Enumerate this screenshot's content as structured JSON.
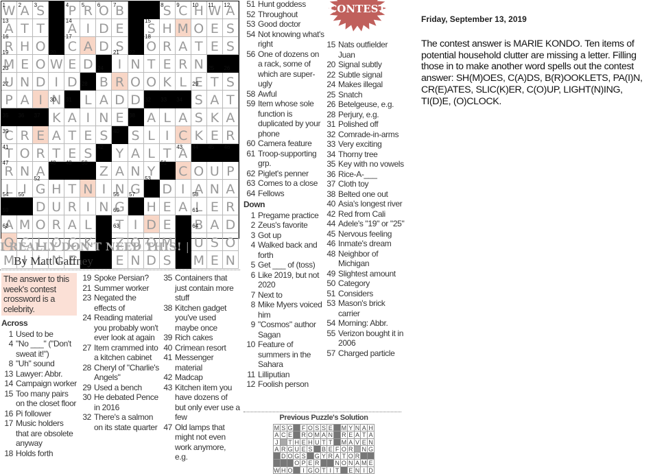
{
  "puzzle": {
    "title": "I REALLY DON'T NEED THIS!",
    "title_separator": "|",
    "byline": "By Matt Gaffney",
    "grid_rows": [
      "WAS#PROB##SCHWA",
      "ATT#AIDE#SHMOES",
      "RHO#CADS#ORATES",
      "MEOWED#INTERN##",
      "UNDID#BROOKLETS",
      "PAIN#LADD###SAT",
      "###KAINE#ALASKA",
      "CREATES#SLICKER",
      "TORTES#YALTA###",
      "RNA###ZANY#COUP",
      "LIGHTNING#DIANA",
      "##DURING#HEALER",
      "AMORAL#TIDE#BAD",
      "OCLOCK#ZOOM#USO",
      "MILNE##ENDS#MEN"
    ],
    "highlighted_cells": [
      [
        2,
        12
      ],
      [
        3,
        6
      ],
      [
        5,
        8
      ],
      [
        6,
        3
      ],
      [
        8,
        3
      ],
      [
        8,
        12
      ],
      [
        10,
        12
      ],
      [
        11,
        6
      ],
      [
        13,
        10
      ],
      [
        14,
        1
      ]
    ],
    "highlight_color": "#f8d6c6",
    "intro": "The answer to this week's contest crossword is a celebrity.",
    "across_label": "Across",
    "down_label": "Down",
    "across": [
      {
        "n": "1",
        "t": "Used to be"
      },
      {
        "n": "4",
        "t": "\"No ___\" (\"Don't sweat it!\")"
      },
      {
        "n": "8",
        "t": "\"Uh\" sound"
      },
      {
        "n": "13",
        "t": "Lawyer: Abbr."
      },
      {
        "n": "14",
        "t": "Campaign worker"
      },
      {
        "n": "15",
        "t": "Too many pairs on the closet floor"
      },
      {
        "n": "16",
        "t": "Pi follower"
      },
      {
        "n": "17",
        "t": "Music holders that are obsolete anyway"
      },
      {
        "n": "18",
        "t": "Holds forth"
      },
      {
        "n": "19",
        "t": "Spoke Persian?"
      },
      {
        "n": "21",
        "t": "Summer worker"
      },
      {
        "n": "23",
        "t": "Negated the effects of"
      },
      {
        "n": "24",
        "t": "Reading material you probably won't ever look at again"
      },
      {
        "n": "27",
        "t": "Item crammed into a kitchen cabinet"
      },
      {
        "n": "28",
        "t": "Cheryl of \"Charlie's Angels\""
      },
      {
        "n": "29",
        "t": "Used a bench"
      },
      {
        "n": "30",
        "t": "He debated Pence in 2016"
      },
      {
        "n": "32",
        "t": "There's a salmon on its state quarter"
      },
      {
        "n": "35",
        "t": "Containers that just contain more stuff"
      },
      {
        "n": "38",
        "t": "Kitchen gadget you've used maybe once"
      },
      {
        "n": "39",
        "t": "Rich cakes"
      },
      {
        "n": "40",
        "t": "Crimean resort"
      },
      {
        "n": "41",
        "t": "Messenger material"
      },
      {
        "n": "42",
        "t": "Madcap"
      },
      {
        "n": "43",
        "t": "Kitchen item you have dozens of but only ever use a few"
      },
      {
        "n": "47",
        "t": "Old lamps that might not even work anymore, e.g."
      },
      {
        "n": "51",
        "t": "Hunt goddess"
      },
      {
        "n": "52",
        "t": "Throughout"
      },
      {
        "n": "53",
        "t": "Good doctor"
      },
      {
        "n": "54",
        "t": "Not knowing what's right"
      },
      {
        "n": "56",
        "t": "One of dozens on a rack, some of which are super-ugly"
      },
      {
        "n": "58",
        "t": "Awful"
      },
      {
        "n": "59",
        "t": "Item whose sole function is duplicated by your phone"
      },
      {
        "n": "60",
        "t": "Camera feature"
      },
      {
        "n": "61",
        "t": "Troop-supporting grp."
      },
      {
        "n": "62",
        "t": "Piglet's penner"
      },
      {
        "n": "63",
        "t": "Comes to a close"
      },
      {
        "n": "64",
        "t": "Fellows"
      }
    ],
    "down": [
      {
        "n": "1",
        "t": "Pregame practice"
      },
      {
        "n": "2",
        "t": "Zeus's favorite"
      },
      {
        "n": "3",
        "t": "Got up"
      },
      {
        "n": "4",
        "t": "Walked back and forth"
      },
      {
        "n": "5",
        "t": "Get ___ of (toss)"
      },
      {
        "n": "6",
        "t": "Like 2019, but not 2020"
      },
      {
        "n": "7",
        "t": "Next to"
      },
      {
        "n": "8",
        "t": "Mike Myers voiced him"
      },
      {
        "n": "9",
        "t": "\"Cosmos\" author Sagan"
      },
      {
        "n": "10",
        "t": "Feature of summers in the Sahara"
      },
      {
        "n": "11",
        "t": "Lilliputian"
      },
      {
        "n": "12",
        "t": "Foolish person"
      },
      {
        "n": "15",
        "t": "Nats outfielder Juan"
      },
      {
        "n": "20",
        "t": "Signal subtly"
      },
      {
        "n": "22",
        "t": "Subtle signal"
      },
      {
        "n": "24",
        "t": "Makes illegal"
      },
      {
        "n": "25",
        "t": "Snatch"
      },
      {
        "n": "26",
        "t": "Betelgeuse, e.g."
      },
      {
        "n": "28",
        "t": "Perjury, e.g."
      },
      {
        "n": "31",
        "t": "Polished off"
      },
      {
        "n": "32",
        "t": "Comrade-in-arms"
      },
      {
        "n": "33",
        "t": "Very exciting"
      },
      {
        "n": "34",
        "t": "Thorny tree"
      },
      {
        "n": "35",
        "t": "Key with no vowels"
      },
      {
        "n": "36",
        "t": "Rice-A-___"
      },
      {
        "n": "37",
        "t": "Cloth toy"
      },
      {
        "n": "38",
        "t": "Belted one out"
      },
      {
        "n": "40",
        "t": "Asia's longest river"
      },
      {
        "n": "42",
        "t": "Red from Cali"
      },
      {
        "n": "44",
        "t": "Adele's \"19\" or \"25\""
      },
      {
        "n": "45",
        "t": "Nervous feeling"
      },
      {
        "n": "46",
        "t": "Inmate's dream"
      },
      {
        "n": "48",
        "t": "Neighbor of Michigan"
      },
      {
        "n": "49",
        "t": "Slightest amount"
      },
      {
        "n": "50",
        "t": "Category"
      },
      {
        "n": "51",
        "t": "Considers"
      },
      {
        "n": "53",
        "t": "Mason's brick carrier"
      },
      {
        "n": "54",
        "t": "Morning: Abbr."
      },
      {
        "n": "55",
        "t": "Verizon bought it in 2006"
      },
      {
        "n": "57",
        "t": "Charged particle"
      }
    ]
  },
  "contest_logo": {
    "text": "CONTEST",
    "color": "#c0605c"
  },
  "previous_solution": {
    "title": "Previous Puzzle's Solution",
    "rows": [
      "MSG#FOSSE#MYNAH",
      "ACE#ROMAN#REATA",
      "J+THEHUTT#MAVEN",
      "ARGUES#BEFOR+NG",
      "#DOGS#GYRATOR##",
      "###OPER##NONAME",
      "WHO#IGOTIT#ENID"
    ]
  },
  "sidebar": {
    "date": "Friday, September 13, 2019",
    "answer": "The contest answer is MARIE KONDO. Ten items of potential household clutter are missing a letter. Filling those in to make another word spells out the contest answer: SH(M)OES, C(A)DS, B(R)OOKLETS, PA(I)N, CR(E)ATES, SLIC(K)ER, C(O)UP, LIGHT(N)ING, TI(D)E, (O)CLOCK."
  }
}
